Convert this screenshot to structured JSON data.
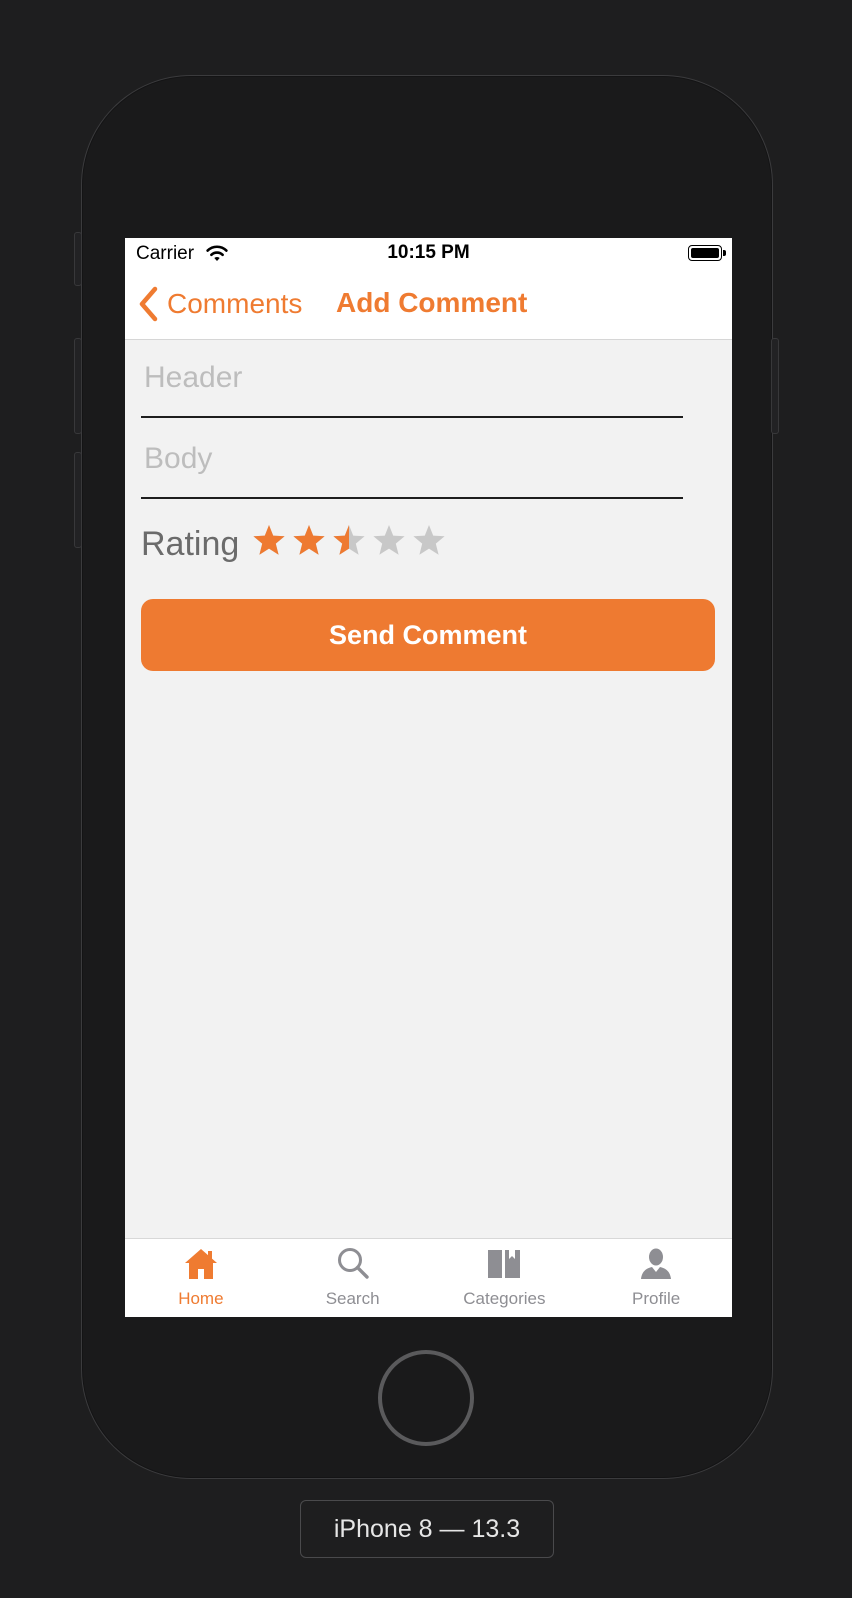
{
  "status_bar": {
    "carrier": "Carrier",
    "time": "10:15 PM",
    "wifi_icon": "wifi-icon",
    "battery_icon": "battery-icon"
  },
  "nav": {
    "back_label": "Comments",
    "back_icon": "chevron-left-icon",
    "title": "Add Comment"
  },
  "form": {
    "header_placeholder": "Header",
    "header_value": "",
    "body_placeholder": "Body",
    "body_value": "",
    "rating_label": "Rating",
    "rating_value": 2.5,
    "rating_max": 5,
    "send_label": "Send Comment"
  },
  "tabs": [
    {
      "label": "Home",
      "icon": "house-icon",
      "active": true
    },
    {
      "label": "Search",
      "icon": "magnifier-icon",
      "active": false
    },
    {
      "label": "Categories",
      "icon": "book-icon",
      "active": false
    },
    {
      "label": "Profile",
      "icon": "person-icon",
      "active": false
    }
  ],
  "device_label": "iPhone 8 — 13.3",
  "colors": {
    "accent": "#EE7A31",
    "star_empty": "#C8C8C8",
    "tab_inactive": "#8E8E93",
    "screen_background": "#F2F2F2",
    "bezel": "#1A1A1B"
  }
}
